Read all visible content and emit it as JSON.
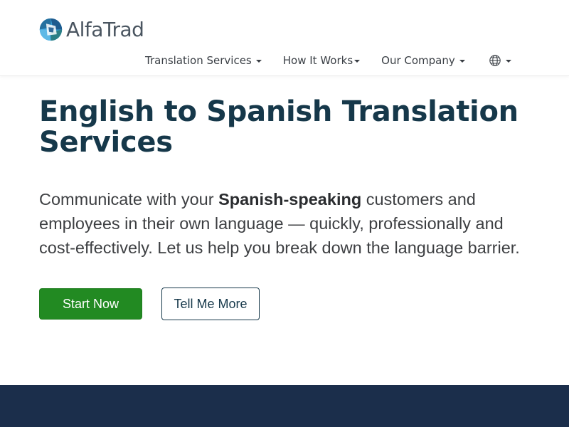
{
  "brand": {
    "name": "AlfaTrad",
    "colors": {
      "logo_blue_dark": "#1e5b8f",
      "logo_blue_light": "#3aa0d8",
      "logo_teal": "#2b7f86",
      "title": "#16384a",
      "primary_button": "#228a22",
      "footer_band": "#1b2e4b"
    }
  },
  "nav": {
    "items": [
      {
        "label": "Translation Services",
        "icon": "chevron-down-icon"
      },
      {
        "label": "How It Works",
        "icon": "chevron-down-icon"
      },
      {
        "label": "Our Company",
        "icon": "chevron-down-icon"
      }
    ],
    "language_icon": "globe-icon"
  },
  "hero": {
    "title": "English to Spanish Translation Services",
    "subtitle_before": "Communicate with your ",
    "subtitle_bold": "Spanish-speaking",
    "subtitle_after": " customers and employees in their own language — quickly, professionally and cost-effectively. Let us help you break down the language barrier.",
    "primary_button": "Start Now",
    "secondary_button": "Tell Me More"
  }
}
